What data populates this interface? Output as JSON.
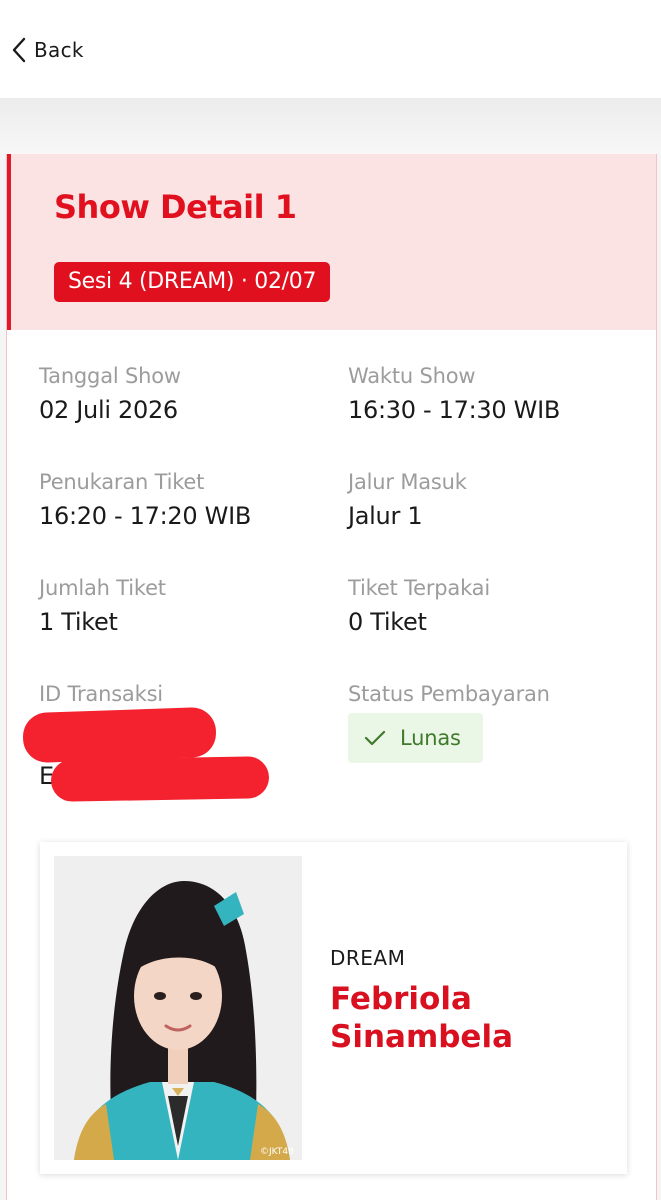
{
  "nav": {
    "back_label": "Back"
  },
  "show": {
    "title": "Show Detail 1",
    "session": "Sesi 4 (DREAM) · 02/07",
    "fields": {
      "tanggal_show": {
        "label": "Tanggal Show",
        "value": "02 Juli 2026"
      },
      "waktu_show": {
        "label": "Waktu Show",
        "value": "16:30 - 17:30 WIB"
      },
      "penukaran_tiket": {
        "label": "Penukaran Tiket",
        "value": "16:20 - 17:20 WIB"
      },
      "jalur_masuk": {
        "label": "Jalur Masuk",
        "value": "Jalur 1"
      },
      "jumlah_tiket": {
        "label": "Jumlah Tiket",
        "value": "1 Tiket"
      },
      "tiket_terpakai": {
        "label": "Tiket Terpakai",
        "value": "0 Tiket"
      },
      "id_transaksi": {
        "label": "ID Transaksi",
        "value_prefix": "E"
      },
      "status_pembayaran": {
        "label": "Status Pembayaran",
        "value": "Lunas"
      }
    }
  },
  "member": {
    "team": "DREAM",
    "name": "Febriola Sinambela",
    "photo_watermark": "©JKT48"
  },
  "colors": {
    "accent": "#e0101f",
    "header_bg": "#fbe3e4",
    "status_bg": "#eaf6e6",
    "status_text": "#3f7a2b",
    "redaction": "#f3222e"
  },
  "icons": {
    "back": "chevron-left-icon",
    "status": "check-icon"
  }
}
